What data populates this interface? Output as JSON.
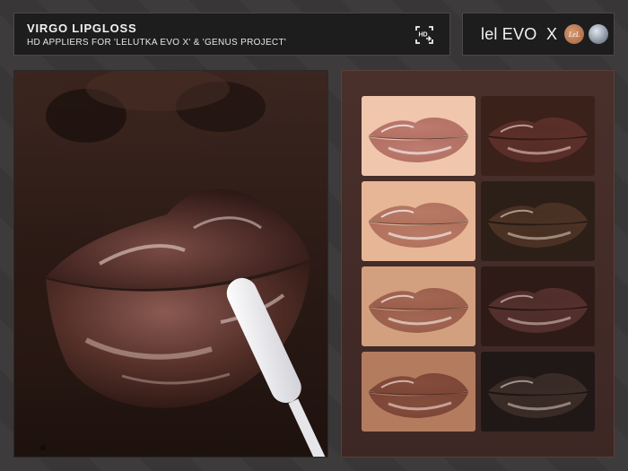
{
  "header": {
    "title": "VIRGO LIPGLOSS",
    "subtitle": "HD APPLIERS FOR 'LELUTKA EVO X' & 'GENUS PROJECT'",
    "hd_icon": "hd-applier-icon"
  },
  "brand": {
    "text": "lel EVO",
    "x": "X",
    "logo_lel_text": "LeL",
    "logo_genus": "genus-logo"
  },
  "hero": {
    "image": "glossy-lips-with-applicator-photo"
  },
  "swatches": [
    {
      "id": "1",
      "skin": "#f0c6ad",
      "lip": "#b36f63",
      "shine": "#ffffff"
    },
    {
      "id": "2",
      "skin": "#3a2119",
      "lip": "#5c2f2a",
      "shine": "#e8c8bc"
    },
    {
      "id": "3",
      "skin": "#e7b696",
      "lip": "#b0705d",
      "shine": "#ffffff"
    },
    {
      "id": "4",
      "skin": "#2c1f17",
      "lip": "#4b3224",
      "shine": "#d8c3b3"
    },
    {
      "id": "5",
      "skin": "#d3a07f",
      "lip": "#9a5d4b",
      "shine": "#fff3ea"
    },
    {
      "id": "6",
      "skin": "#2e1b18",
      "lip": "#54302d",
      "shine": "#d9bfb8"
    },
    {
      "id": "7",
      "skin": "#b47c5e",
      "lip": "#7c4536",
      "shine": "#f6ded2"
    },
    {
      "id": "8",
      "skin": "#1f1816",
      "lip": "#3b2c27",
      "shine": "#cdbdb5"
    }
  ]
}
